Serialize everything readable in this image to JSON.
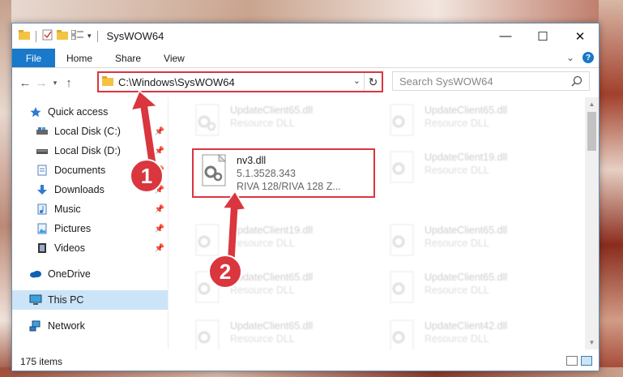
{
  "window": {
    "title": "SysWOW64",
    "controls": {
      "minimize": "—",
      "maximize": "☐",
      "close": "✕"
    }
  },
  "ribbon": {
    "tabs": [
      "File",
      "Home",
      "Share",
      "View"
    ],
    "expand": "⌄",
    "help": "?"
  },
  "address": {
    "path": "C:\\Windows\\SysWOW64",
    "search_placeholder": "Search SysWOW64"
  },
  "nav": {
    "items": [
      {
        "label": "Quick access",
        "icon": "star-icon",
        "pinned": false
      },
      {
        "label": "Local Disk (C:)",
        "icon": "drive-icon",
        "pinned": true
      },
      {
        "label": "Local Disk (D:)",
        "icon": "drive-icon",
        "pinned": true
      },
      {
        "label": "Documents",
        "icon": "documents-icon",
        "pinned": true
      },
      {
        "label": "Downloads",
        "icon": "download-icon",
        "pinned": true
      },
      {
        "label": "Music",
        "icon": "music-icon",
        "pinned": true
      },
      {
        "label": "Pictures",
        "icon": "pictures-icon",
        "pinned": true
      },
      {
        "label": "Videos",
        "icon": "videos-icon",
        "pinned": true
      },
      {
        "label": "OneDrive",
        "icon": "cloud-icon",
        "pinned": false
      },
      {
        "label": "This PC",
        "icon": "computer-icon",
        "pinned": false,
        "selected": true
      },
      {
        "label": "Network",
        "icon": "network-icon",
        "pinned": false
      }
    ]
  },
  "files": {
    "col1": [
      {
        "name": "UpdateClient65.dll",
        "sub": "Resource DLL",
        "faded": true
      },
      {
        "name": "nv3.dll",
        "version": "5.1.3528.343",
        "desc": "RIVA 128/RIVA 128 Z...",
        "faded": false
      },
      {
        "name": "UpdateClient19.dll",
        "sub": "Resource DLL",
        "faded": true
      },
      {
        "name": "UpdateClient65.dll",
        "sub": "Resource DLL",
        "faded": true
      },
      {
        "name": "UpdateClient65.dll",
        "sub": "Resource DLL",
        "faded": true
      }
    ],
    "col2": [
      {
        "name": "UpdateClient65.dll",
        "sub": "Resource DLL"
      },
      {
        "name": "UpdateClient19.dll",
        "sub": "Resource DLL"
      },
      {
        "name": "UpdateClient65.dll",
        "sub": "Resource DLL"
      },
      {
        "name": "UpdateClient65.dll",
        "sub": "Resource DLL"
      },
      {
        "name": "UpdateClient42.dll",
        "sub": "Resource DLL"
      }
    ]
  },
  "status": {
    "count": "175 items"
  },
  "annotations": {
    "step1": "1",
    "step2": "2"
  },
  "colors": {
    "accent": "#1979ca",
    "highlight": "#d9363e",
    "selected": "#cce4f7"
  }
}
